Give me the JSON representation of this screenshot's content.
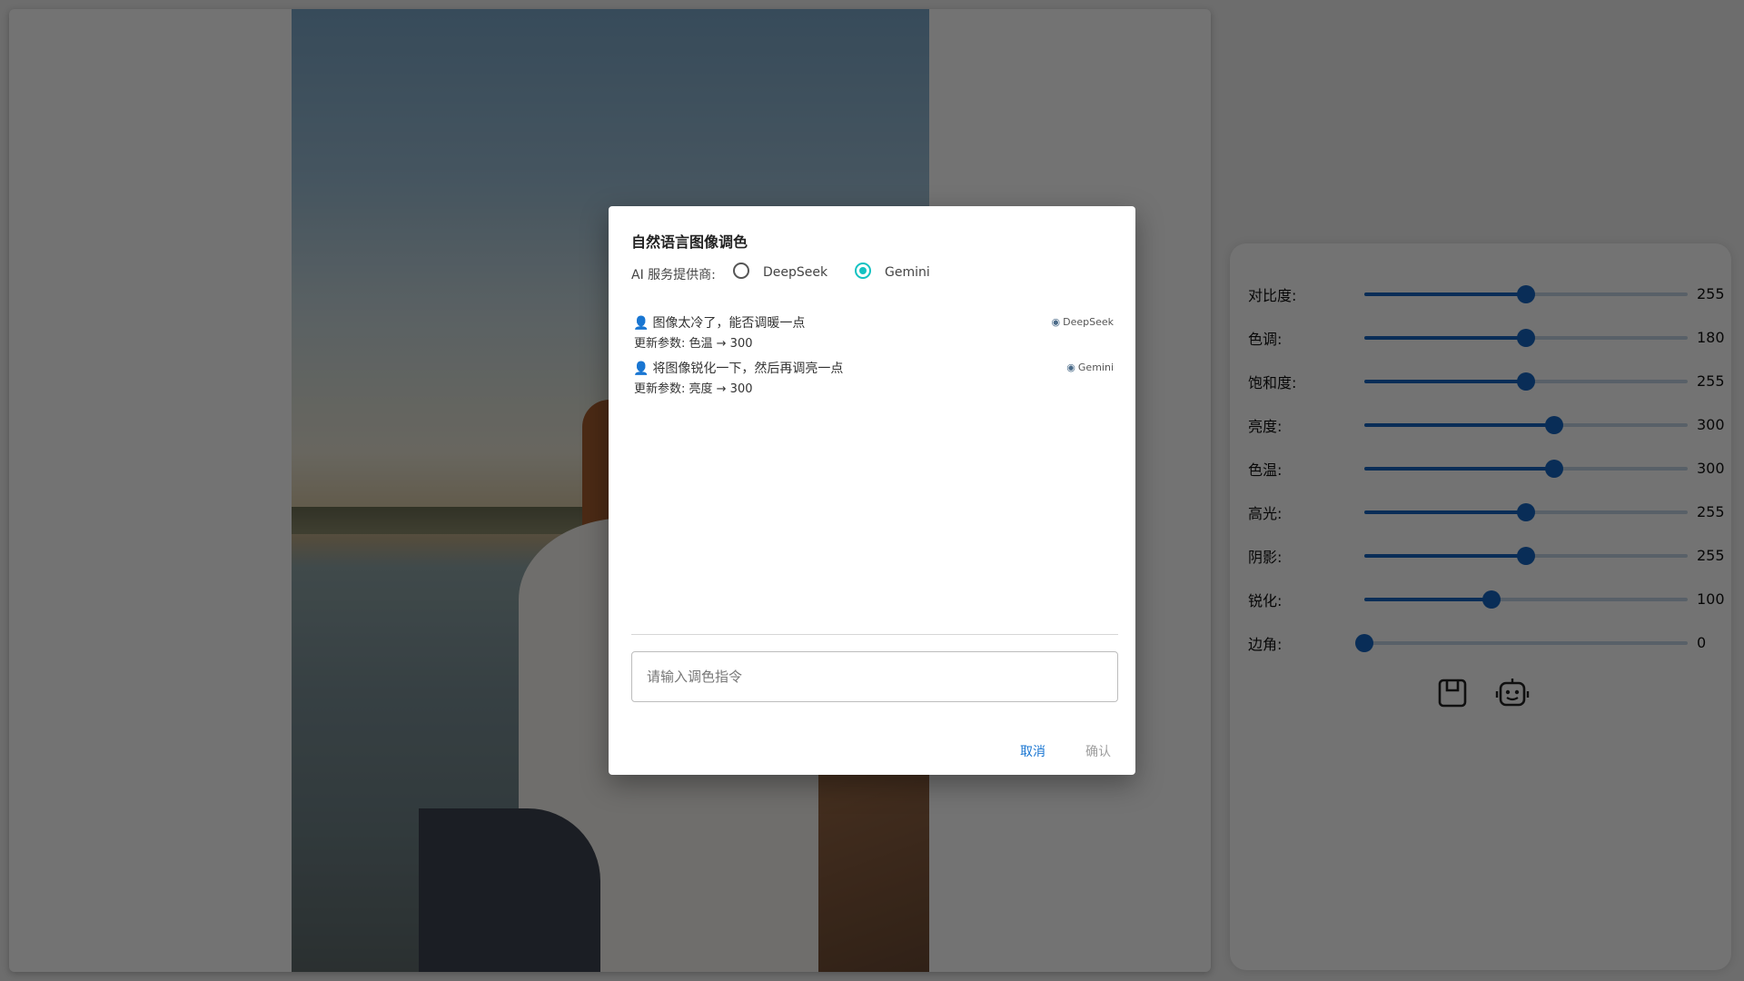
{
  "sliders": [
    {
      "label": "对比度:",
      "value": "255",
      "fraction": 0.5
    },
    {
      "label": "色调:",
      "value": "180",
      "fraction": 0.5
    },
    {
      "label": "饱和度:",
      "value": "255",
      "fraction": 0.5
    },
    {
      "label": "亮度:",
      "value": "300",
      "fraction": 0.588
    },
    {
      "label": "色温:",
      "value": "300",
      "fraction": 0.588
    },
    {
      "label": "高光:",
      "value": "255",
      "fraction": 0.5
    },
    {
      "label": "阴影:",
      "value": "255",
      "fraction": 0.5
    },
    {
      "label": "锐化:",
      "value": "100",
      "fraction": 0.392
    },
    {
      "label": "边角:",
      "value": "0",
      "fraction": 0.0
    }
  ],
  "panel_actions": {
    "save_icon": "save-icon",
    "ai_icon": "robot-icon"
  },
  "dialog": {
    "title": "自然语言图像调色",
    "provider_label": "AI 服务提供商:",
    "providers": [
      {
        "name": "DeepSeek",
        "selected": false
      },
      {
        "name": "Gemini",
        "selected": true
      }
    ],
    "messages": [
      {
        "user_text": "图像太冷了，能否调暖一点",
        "result_text": "更新参数: 色温 → 300",
        "provider": "DeepSeek"
      },
      {
        "user_text": "将图像锐化一下，然后再调亮一点",
        "result_text": "更新参数: 亮度 → 300",
        "provider": "Gemini"
      }
    ],
    "input_placeholder": "请输入调色指令",
    "cancel_label": "取消",
    "confirm_label": "确认"
  },
  "colors": {
    "accent": "#1565c0",
    "radio_checked": "#13c2c2",
    "cancel": "#1976d2"
  }
}
